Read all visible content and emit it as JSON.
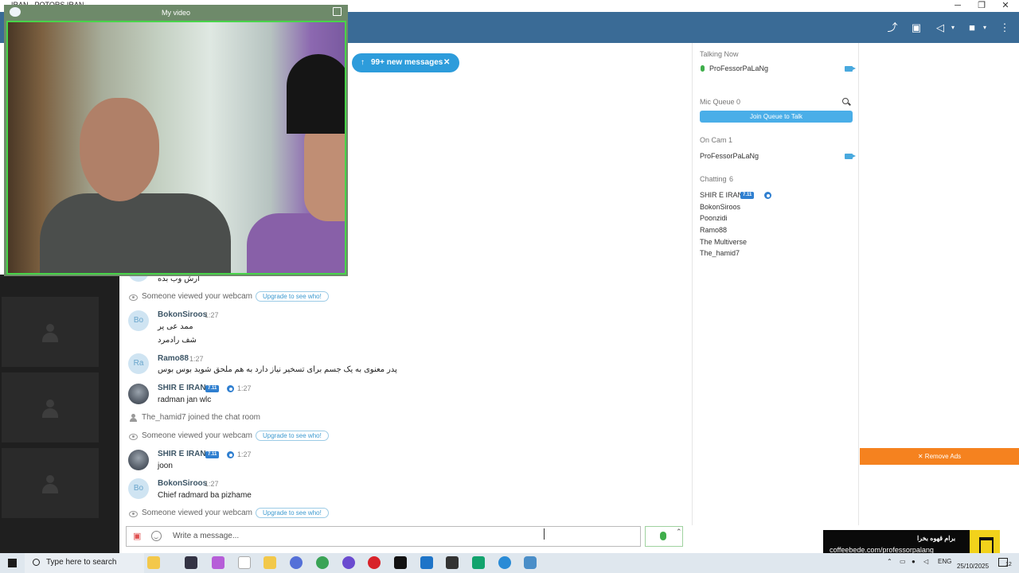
{
  "window": {
    "title": "IRAN - POTORS IRAN",
    "controls": [
      "─",
      "❐",
      "✕"
    ]
  },
  "header": {
    "icons": [
      "share-icon",
      "gift-icon",
      "speaker-icon",
      "camera-icon",
      "more-icon"
    ]
  },
  "video": {
    "title": "My video"
  },
  "new_messages": {
    "label": "99+ new messages",
    "arrow": "↑",
    "close": "✕"
  },
  "chat": {
    "top_partial_text": "ارش وب بده",
    "sys_viewed": "Someone viewed your webcam",
    "upgrade": "Upgrade to see who!",
    "messages": [
      {
        "avatar": "Bo",
        "name": "BokonSiroos",
        "time": "1:27",
        "lines": [
          "ممد عی یر",
          "شف رادمرد"
        ]
      },
      {
        "avatar": "Ra",
        "name": "Ramo88",
        "time": "1:27",
        "lines": [
          "پدر معنوی به یک جسم برای تسخیر نیاز دارد به هم ملحق شوید بوس بوس"
        ]
      },
      {
        "avatar": "",
        "name": "SHIR E IRAN",
        "badge": "7.11",
        "time": "1:27",
        "lines": [
          "radman jan wlc"
        ]
      },
      {
        "avatar": "",
        "name": "SHIR E IRAN",
        "badge": "7.11",
        "time": "1:27",
        "lines": [
          "joon"
        ]
      },
      {
        "avatar": "Bo",
        "name": "BokonSiroos",
        "time": "1:27",
        "lines": [
          "Chief radmard ba pizhame"
        ]
      }
    ],
    "joined": "The_hamid7 joined the chat room"
  },
  "input": {
    "placeholder": "Write a message...",
    "caret": "⌃"
  },
  "panel": {
    "talking_now": {
      "label": "Talking Now",
      "user": "ProFessorPaLaNg"
    },
    "mic_queue": {
      "label": "Mic Queue",
      "count": "0",
      "button": "Join Queue to Talk"
    },
    "on_cam": {
      "label": "On Cam",
      "count": "1",
      "user": "ProFessorPaLaNg"
    },
    "chatting": {
      "label": "Chatting",
      "count": "6",
      "users": [
        "SHIR E IRAN",
        "BokonSiroos",
        "Poonzidi",
        "Ramo88",
        "The Multiverse",
        "The_hamid7"
      ],
      "badge": "7.11"
    }
  },
  "ads": {
    "remove": "✕ Remove Ads",
    "coffee_title": "برام قهوه بخرا",
    "coffee_url": "coffeebede.com/professorpalang"
  },
  "taskbar": {
    "search": "Type here to search",
    "lang": "ENG",
    "date": "25/10/2025",
    "notif": "12"
  },
  "colors": {
    "header": "#3a6b96",
    "accent": "#2d9cdb",
    "ads": "#f5821f",
    "cam_border": "#48d44a"
  }
}
